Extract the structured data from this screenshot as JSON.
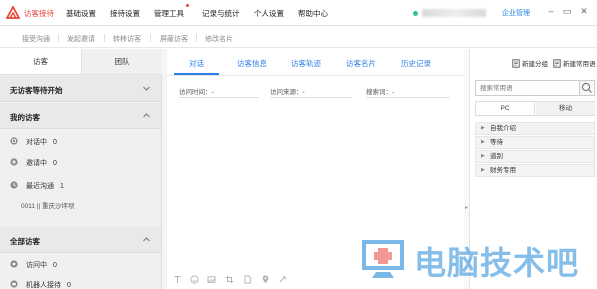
{
  "menu": {
    "items": [
      "访客接待",
      "基础设置",
      "接待设置",
      "管理工具",
      "记录与统计",
      "个人设置",
      "帮助中心"
    ],
    "active_index": 0,
    "company_link": "企业管理",
    "status_color": "#2fc58b",
    "accent_color": "#e8453c"
  },
  "subbar": {
    "items": [
      "接受沟通",
      "发起邀请",
      "转移访客",
      "屏蔽访客",
      "修改名片"
    ]
  },
  "left": {
    "tabs": [
      "访客",
      "团队"
    ],
    "waiting_title": "无访客等待开始",
    "my_visitors": {
      "title": "我的访客",
      "rows": [
        {
          "label": "对话中",
          "count": "0",
          "icon": "chat-icon"
        },
        {
          "label": "邀请中",
          "count": "0",
          "icon": "invite-icon"
        },
        {
          "label": "最近沟通",
          "count": "1",
          "icon": "history-icon"
        }
      ],
      "visitor_item": "0011 || 重庆沙坪坝"
    },
    "all_visitors": {
      "title": "全部访客",
      "rows": [
        {
          "label": "访问中",
          "count": "0",
          "icon": "visiting-icon"
        },
        {
          "label": "机器人接待",
          "count": "0",
          "icon": "robot-icon"
        }
      ]
    }
  },
  "center": {
    "tabs": [
      "对话",
      "访客信息",
      "访客轨迹",
      "访客名片",
      "历史记录"
    ],
    "active_tab": 0,
    "filters": {
      "time_label": "访问时间：-",
      "source_label": "访问来源：-",
      "keyword_label": "搜索词：-"
    },
    "toolbar_icons": [
      "text-icon",
      "emoji-icon",
      "image-icon",
      "screenshot-icon",
      "file-icon",
      "location-icon",
      "link-icon"
    ],
    "accent_color": "#2b7de9"
  },
  "right": {
    "tools": [
      "新建分组",
      "新建常用语"
    ],
    "search_placeholder": "搜索常用语",
    "tabs": [
      "PC",
      "移动"
    ],
    "categories": [
      "自我介绍",
      "等待",
      "道别",
      "财务专用"
    ]
  },
  "watermark": {
    "text": "电脑技术吧",
    "color": "#2189d6"
  }
}
